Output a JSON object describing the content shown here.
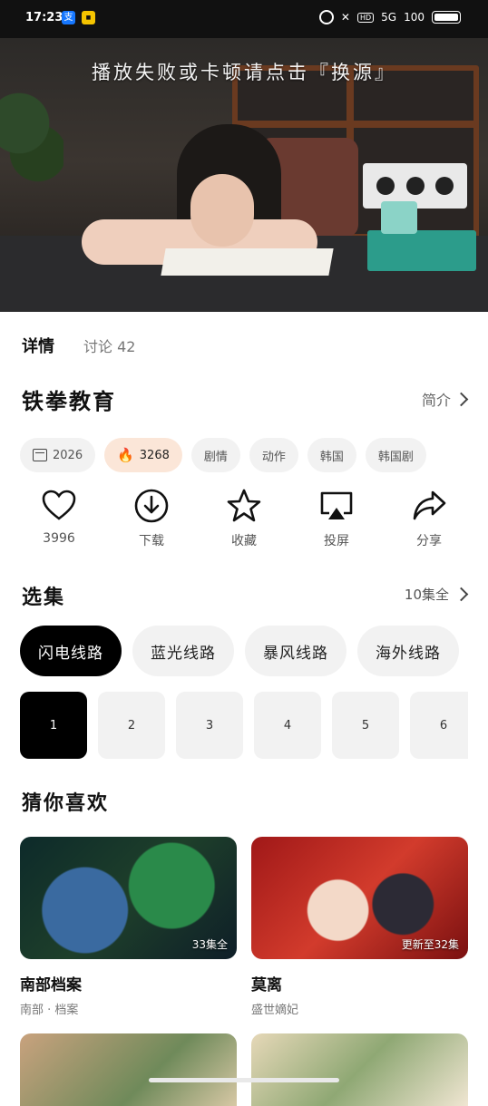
{
  "status_bar": {
    "time": "17:23",
    "app1_icon": "alipay-icon",
    "app2_icon": "app-badge-icon",
    "right_text": "HD",
    "signal": "5G",
    "battery_text": "100"
  },
  "video": {
    "tip": "播放失败或卡顿请点击『换源』"
  },
  "tabs": [
    {
      "label": "详情"
    },
    {
      "label": "讨论 42"
    }
  ],
  "show": {
    "title": "铁拳教育",
    "intro_label": "简介"
  },
  "tags": [
    {
      "label": "2026",
      "icon": "calendar-icon"
    },
    {
      "label": "3268",
      "icon": "flame-icon"
    },
    {
      "label": "剧情"
    },
    {
      "label": "动作"
    },
    {
      "label": "韩国"
    },
    {
      "label": "韩国剧"
    }
  ],
  "actions": [
    {
      "label": "3996",
      "icon": "heart-icon"
    },
    {
      "label": "下载",
      "icon": "download-icon"
    },
    {
      "label": "收藏",
      "icon": "star-icon"
    },
    {
      "label": "投屏",
      "icon": "cast-icon"
    },
    {
      "label": "分享",
      "icon": "share-icon"
    }
  ],
  "episodes": {
    "title": "选集",
    "count_label": "10集全",
    "lines": [
      "闪电线路",
      "蓝光线路",
      "暴风线路",
      "海外线路"
    ],
    "active_line": 0,
    "items": [
      "1",
      "2",
      "3",
      "4",
      "5",
      "6"
    ],
    "active_episode": 0
  },
  "recommend": {
    "title": "猜你喜欢",
    "cards": [
      {
        "name": "南部档案",
        "sub": "南部 · 档案",
        "badge": "33集全"
      },
      {
        "name": "莫离",
        "sub": "盛世嫡妃",
        "badge": "更新至32集"
      }
    ]
  }
}
